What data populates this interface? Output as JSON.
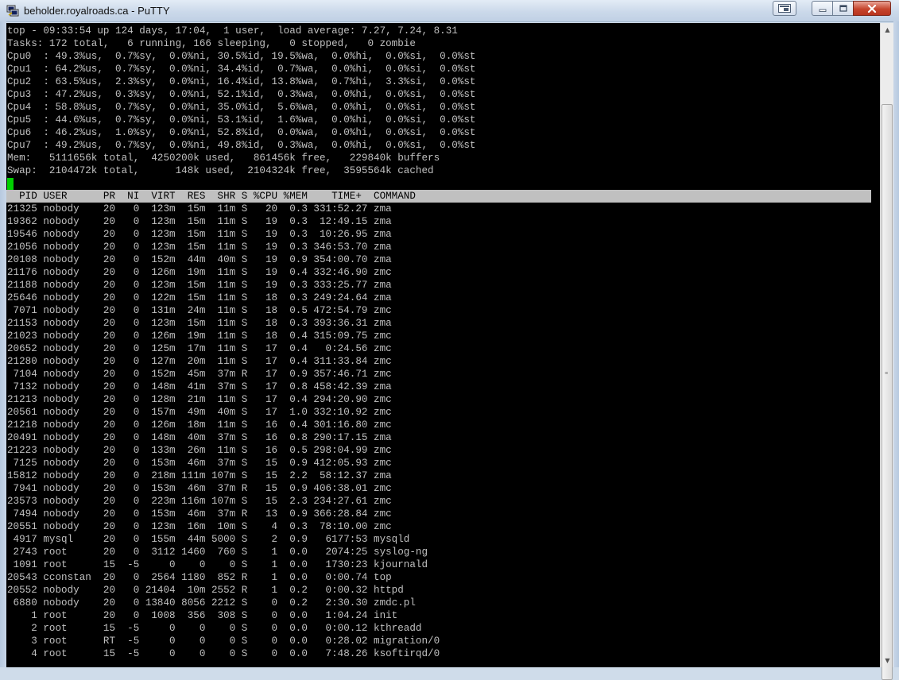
{
  "window": {
    "title": "beholder.royalroads.ca - PuTTY",
    "icon": "putty-icon",
    "controls": {
      "extra": "system-menu-icon",
      "minimize": "minimize-icon",
      "maximize": "maximize-icon",
      "close": "close-icon"
    }
  },
  "terminal": {
    "summary": [
      "top - 09:33:54 up 124 days, 17:04,  1 user,  load average: 7.27, 7.24, 8.31",
      "Tasks: 172 total,   6 running, 166 sleeping,   0 stopped,   0 zombie",
      "Cpu0  : 49.3%us,  0.7%sy,  0.0%ni, 30.5%id, 19.5%wa,  0.0%hi,  0.0%si,  0.0%st",
      "Cpu1  : 64.2%us,  0.7%sy,  0.0%ni, 34.4%id,  0.7%wa,  0.0%hi,  0.0%si,  0.0%st",
      "Cpu2  : 63.5%us,  2.3%sy,  0.0%ni, 16.4%id, 13.8%wa,  0.7%hi,  3.3%si,  0.0%st",
      "Cpu3  : 47.2%us,  0.3%sy,  0.0%ni, 52.1%id,  0.3%wa,  0.0%hi,  0.0%si,  0.0%st",
      "Cpu4  : 58.8%us,  0.7%sy,  0.0%ni, 35.0%id,  5.6%wa,  0.0%hi,  0.0%si,  0.0%st",
      "Cpu5  : 44.6%us,  0.7%sy,  0.0%ni, 53.1%id,  1.6%wa,  0.0%hi,  0.0%si,  0.0%st",
      "Cpu6  : 46.2%us,  1.0%sy,  0.0%ni, 52.8%id,  0.0%wa,  0.0%hi,  0.0%si,  0.0%st",
      "Cpu7  : 49.2%us,  0.7%sy,  0.0%ni, 49.8%id,  0.3%wa,  0.0%hi,  0.0%si,  0.0%st",
      "Mem:   5111656k total,  4250200k used,   861456k free,   229840k buffers",
      "Swap:  2104472k total,      148k used,  2104324k free,  3595564k cached"
    ],
    "header": "  PID USER      PR  NI  VIRT  RES  SHR S %CPU %MEM    TIME+  COMMAND",
    "processes": [
      "21325 nobody    20   0  123m  15m  11m S   20  0.3 331:52.27 zma",
      "19362 nobody    20   0  123m  15m  11m S   19  0.3  12:49.15 zma",
      "19546 nobody    20   0  123m  15m  11m S   19  0.3  10:26.95 zma",
      "21056 nobody    20   0  123m  15m  11m S   19  0.3 346:53.70 zma",
      "20108 nobody    20   0  152m  44m  40m S   19  0.9 354:00.70 zma",
      "21176 nobody    20   0  126m  19m  11m S   19  0.4 332:46.90 zmc",
      "21188 nobody    20   0  123m  15m  11m S   19  0.3 333:25.77 zma",
      "25646 nobody    20   0  122m  15m  11m S   18  0.3 249:24.64 zma",
      " 7071 nobody    20   0  131m  24m  11m S   18  0.5 472:54.79 zmc",
      "21153 nobody    20   0  123m  15m  11m S   18  0.3 393:36.31 zma",
      "21023 nobody    20   0  126m  19m  11m S   18  0.4 315:09.75 zmc",
      "20652 nobody    20   0  125m  17m  11m S   17  0.4   0:24.56 zmc",
      "21280 nobody    20   0  127m  20m  11m S   17  0.4 311:33.84 zmc",
      " 7104 nobody    20   0  152m  45m  37m R   17  0.9 357:46.71 zmc",
      " 7132 nobody    20   0  148m  41m  37m S   17  0.8 458:42.39 zma",
      "21213 nobody    20   0  128m  21m  11m S   17  0.4 294:20.90 zmc",
      "20561 nobody    20   0  157m  49m  40m S   17  1.0 332:10.92 zmc",
      "21218 nobody    20   0  126m  18m  11m S   16  0.4 301:16.80 zmc",
      "20491 nobody    20   0  148m  40m  37m S   16  0.8 290:17.15 zma",
      "21223 nobody    20   0  133m  26m  11m S   16  0.5 298:04.99 zmc",
      " 7125 nobody    20   0  153m  46m  37m S   15  0.9 412:05.93 zmc",
      "15812 nobody    20   0  218m 111m 107m S   15  2.2  58:12.37 zma",
      " 7941 nobody    20   0  153m  46m  37m R   15  0.9 406:38.01 zmc",
      "23573 nobody    20   0  223m 116m 107m S   15  2.3 234:27.61 zmc",
      " 7494 nobody    20   0  153m  46m  37m R   13  0.9 366:28.84 zmc",
      "20551 nobody    20   0  123m  16m  10m S    4  0.3  78:10.00 zmc",
      " 4917 mysql     20   0  155m  44m 5000 S    2  0.9   6177:53 mysqld",
      " 2743 root      20   0  3112 1460  760 S    1  0.0   2074:25 syslog-ng",
      " 1091 root      15  -5     0    0    0 S    1  0.0   1730:23 kjournald",
      "20543 cconstan  20   0  2564 1180  852 R    1  0.0   0:00.74 top",
      "20552 nobody    20   0 21404  10m 2552 R    1  0.2   0:00.32 httpd",
      " 6880 nobody    20   0 13840 8056 2212 S    0  0.2   2:30.30 zmdc.pl",
      "    1 root      20   0  1008  356  308 S    0  0.0   1:04.24 init",
      "    2 root      15  -5     0    0    0 S    0  0.0   0:00.12 kthreadd",
      "    3 root      RT  -5     0    0    0 S    0  0.0   0:28.02 migration/0",
      "    4 root      15  -5     0    0    0 S    0  0.0   7:48.26 ksoftirqd/0"
    ]
  },
  "scrollbar": {
    "up": "▲",
    "down": "▼",
    "grip": "≡"
  },
  "colors": {
    "terminal_bg": "#000000",
    "terminal_fg": "#c0c0c0",
    "cursor": "#00d000",
    "header_bg": "#c0c0c0"
  }
}
